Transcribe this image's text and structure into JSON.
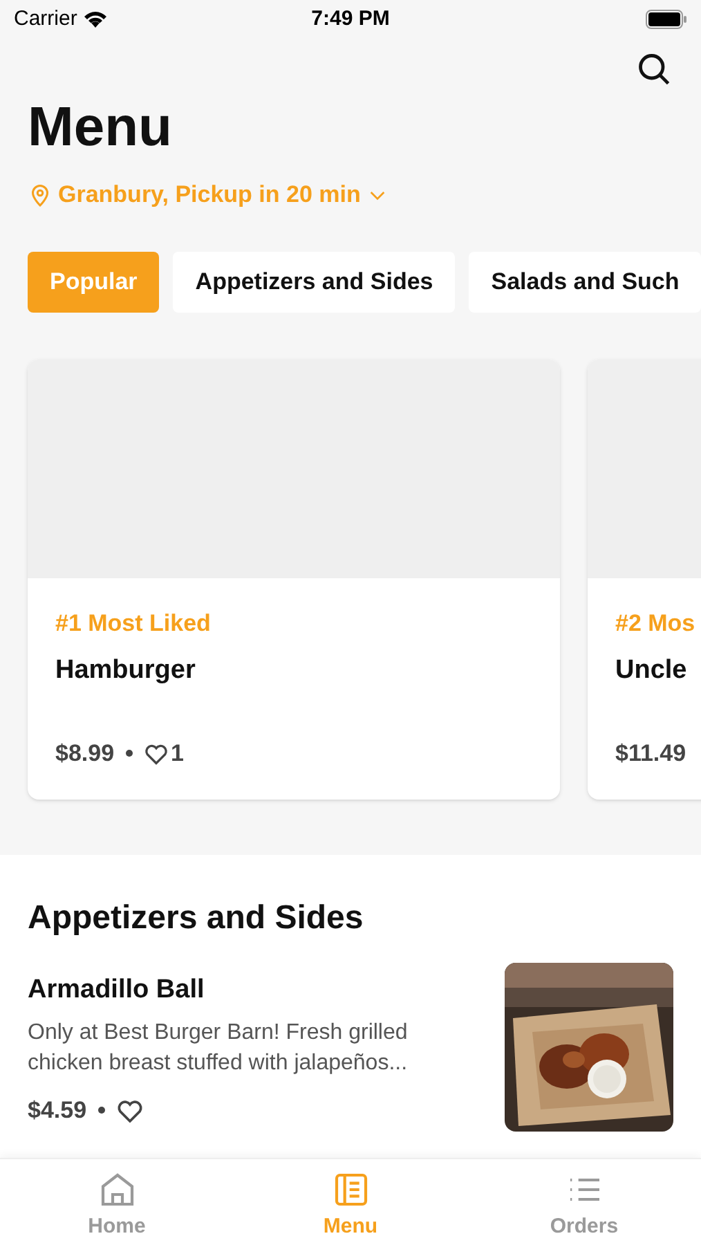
{
  "status_bar": {
    "carrier": "Carrier",
    "time": "7:49 PM"
  },
  "header": {
    "title": "Menu",
    "location": "Granbury, Pickup in 20 min"
  },
  "categories": [
    {
      "label": "Popular",
      "selected": true
    },
    {
      "label": "Appetizers and Sides",
      "selected": false
    },
    {
      "label": "Salads and Such",
      "selected": false
    }
  ],
  "featured": [
    {
      "rank": "#1 Most Liked",
      "name": "Hamburger",
      "price": "$8.99",
      "likes": "1"
    },
    {
      "rank": "#2 Mos",
      "name": "Uncle",
      "price": "$11.49"
    }
  ],
  "section": {
    "title": "Appetizers and Sides",
    "items": [
      {
        "name": "Armadillo Ball",
        "description": "Only at Best Burger Barn! Fresh grilled chicken breast stuffed with jalapeños...",
        "price": "$4.59"
      }
    ]
  },
  "tab_bar": [
    {
      "label": "Home",
      "kind": "home",
      "selected": false
    },
    {
      "label": "Menu",
      "kind": "menu",
      "selected": true
    },
    {
      "label": "Orders",
      "kind": "orders",
      "selected": false
    }
  ]
}
